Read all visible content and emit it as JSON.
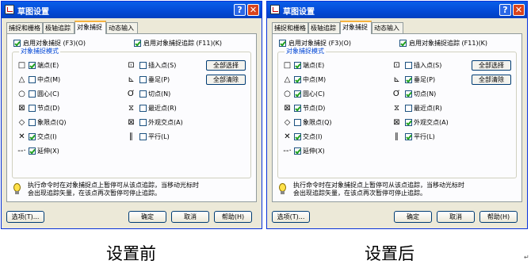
{
  "dialogs": [
    {
      "title": "草图设置",
      "tabs": [
        "捕捉和栅格",
        "极轴追踪",
        "对象捕捉",
        "动态输入"
      ],
      "enable_osnap": {
        "label": "启用对象捕捉 (F3)(O)",
        "checked": true
      },
      "enable_tracking": {
        "label": "启用对象捕捉追踪 (F11)(K)",
        "checked": true
      },
      "group_title": "对象捕捉模式",
      "modes_left": [
        {
          "icon": "□",
          "label": "端点(E)",
          "checked": true
        },
        {
          "icon": "△",
          "label": "中点(M)",
          "checked": false
        },
        {
          "icon": "○",
          "label": "圆心(C)",
          "checked": false
        },
        {
          "icon": "⊠",
          "label": "节点(D)",
          "checked": false
        },
        {
          "icon": "◇",
          "label": "象限点(Q)",
          "checked": false
        },
        {
          "icon": "✕",
          "label": "交点(I)",
          "checked": true
        },
        {
          "icon": "--·",
          "label": "延伸(X)",
          "checked": true
        }
      ],
      "modes_right": [
        {
          "icon": "⊡",
          "label": "插入点(S)",
          "checked": false
        },
        {
          "icon": "⊾",
          "label": "垂足(P)",
          "checked": false
        },
        {
          "icon": "Ơ",
          "label": "切点(N)",
          "checked": false
        },
        {
          "icon": "⧖",
          "label": "最近点(R)",
          "checked": false
        },
        {
          "icon": "⊠",
          "label": "外观交点(A)",
          "checked": false
        },
        {
          "icon": "∥",
          "label": "平行(L)",
          "checked": false
        }
      ],
      "select_all": "全部选择",
      "clear_all": "全部清除",
      "info_line1": "执行命令时在对象捕捉点上暂停可从该点追踪，当移动光标时",
      "info_line2": "会出现追踪矢量，在该点再次暂停可停止追踪。",
      "buttons": {
        "options": "选项(T)...",
        "ok": "确定",
        "cancel": "取消",
        "help": "帮助(H)"
      }
    },
    {
      "title": "草图设置",
      "tabs": [
        "捕捉和栅格",
        "极轴追踪",
        "对象捕捉",
        "动态输入"
      ],
      "enable_osnap": {
        "label": "启用对象捕捉 (F3)(O)",
        "checked": true
      },
      "enable_tracking": {
        "label": "启用对象捕捉追踪 (F11)(K)",
        "checked": true
      },
      "group_title": "对象捕捉模式",
      "modes_left": [
        {
          "icon": "□",
          "label": "端点(E)",
          "checked": true
        },
        {
          "icon": "△",
          "label": "中点(M)",
          "checked": true
        },
        {
          "icon": "○",
          "label": "圆心(C)",
          "checked": true
        },
        {
          "icon": "⊠",
          "label": "节点(D)",
          "checked": true
        },
        {
          "icon": "◇",
          "label": "象限点(Q)",
          "checked": false
        },
        {
          "icon": "✕",
          "label": "交点(I)",
          "checked": true
        },
        {
          "icon": "--·",
          "label": "延伸(X)",
          "checked": true
        }
      ],
      "modes_right": [
        {
          "icon": "⊡",
          "label": "插入点(S)",
          "checked": false
        },
        {
          "icon": "⊾",
          "label": "垂足(P)",
          "checked": true
        },
        {
          "icon": "Ơ",
          "label": "切点(N)",
          "checked": true
        },
        {
          "icon": "⧖",
          "label": "最近点(R)",
          "checked": false
        },
        {
          "icon": "⊠",
          "label": "外观交点(A)",
          "checked": true
        },
        {
          "icon": "∥",
          "label": "平行(L)",
          "checked": true
        }
      ],
      "select_all": "全部选择",
      "clear_all": "全部清除",
      "info_line1": "执行命令时在对象捕捉点上暂停可从该点追踪，当移动光标时",
      "info_line2": "会出现追踪矢量，在该点再次暂停可停止追踪。",
      "buttons": {
        "options": "选项(T)...",
        "ok": "确定",
        "cancel": "取消",
        "help": "帮助(H)"
      }
    }
  ],
  "captions": [
    "设置前",
    "设置后"
  ],
  "colors": {
    "title_bar": "#0349d6",
    "dialog_bg": "#ece9d8",
    "group_title": "#0046d5",
    "check": "#21a121"
  }
}
